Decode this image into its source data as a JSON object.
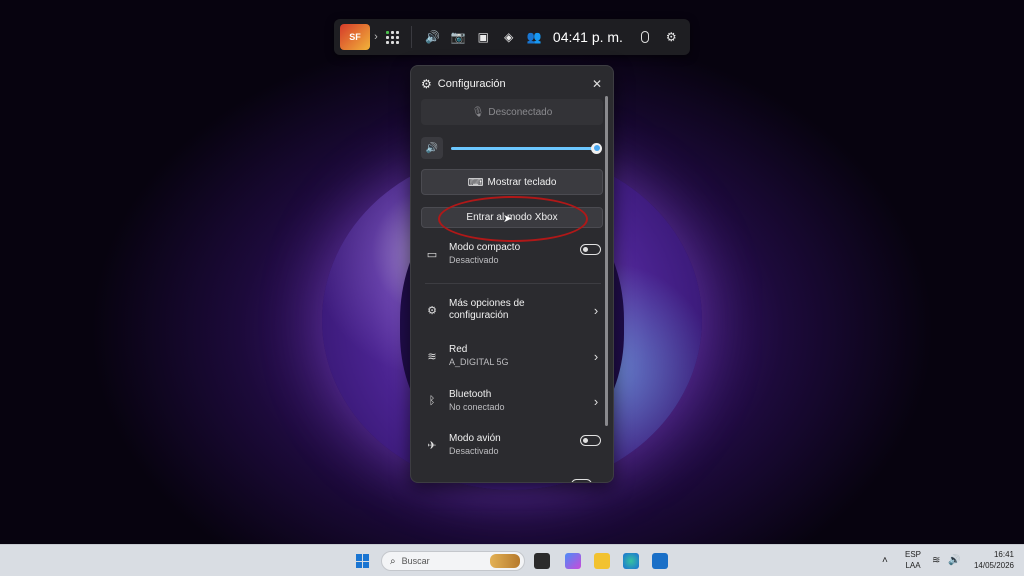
{
  "game_bar": {
    "thumb_label": "SF",
    "time": "04:41 p. m."
  },
  "settings_panel": {
    "title": "Configuración",
    "mic_button_label": "Desconectado",
    "volume_percent": 100,
    "keyboard_button_label": "Mostrar teclado",
    "xbox_button_label": "Entrar al modo Xbox",
    "compact_mode": {
      "label": "Modo compacto",
      "status": "Desactivado"
    },
    "more_settings": {
      "label_line1": "Más opciones de",
      "label_line2": "configuración"
    },
    "network": {
      "label": "Red",
      "status": "A_DIGITAL 5G"
    },
    "bluetooth": {
      "label": "Bluetooth",
      "status": "No conectado"
    },
    "airplane_mode": {
      "label": "Modo avión",
      "status": "Desactivado"
    }
  },
  "taskbar": {
    "search_placeholder": "Buscar",
    "language_line1": "ESP",
    "language_line2": "LAA",
    "clock_time": "16:41",
    "clock_date": "14/05/2026"
  },
  "colors": {
    "slider_fill": "#6cc7ff",
    "highlight_ring": "#b01818",
    "windows_blue": "#1a75d2"
  }
}
